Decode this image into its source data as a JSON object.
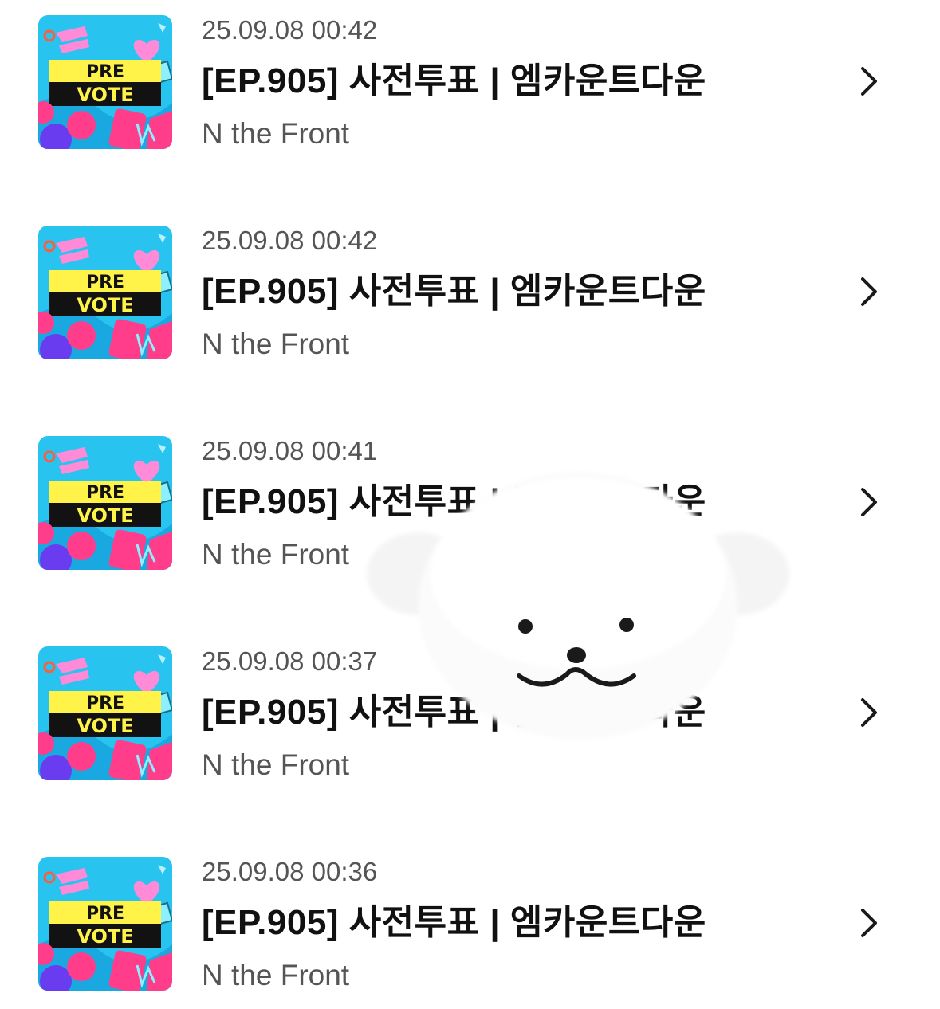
{
  "thumbnail": {
    "line1": "PRE",
    "line2": "VOTE",
    "icon": "pre-vote-artwork"
  },
  "items": [
    {
      "date": "25.09.08 00:42",
      "title": "[EP.905] 사전투표 | 엠카운트다운",
      "artist": "N the Front"
    },
    {
      "date": "25.09.08 00:42",
      "title": "[EP.905] 사전투표 | 엠카운트다운",
      "artist": "N the Front"
    },
    {
      "date": "25.09.08 00:41",
      "title": "[EP.905] 사전투표 | 엠카운트다운",
      "artist": "N the Front"
    },
    {
      "date": "25.09.08 00:37",
      "title": "[EP.905] 사전투표 | 엠카운트다운",
      "artist": "N the Front"
    },
    {
      "date": "25.09.08 00:36",
      "title": "[EP.905] 사전투표 | 엠카운트다운",
      "artist": "N the Front"
    }
  ],
  "chevron_icon": "chevron-right-icon",
  "overlay": {
    "icon": "white-puppy-sticker"
  },
  "colors": {
    "text_primary": "#111111",
    "text_secondary": "#555555",
    "thumb_bg": "#29c3f0",
    "thumb_band": "#fff34a",
    "thumb_dark": "#121212",
    "thumb_pink": "#ff3d8b",
    "thumb_purple": "#6a3cf0"
  }
}
